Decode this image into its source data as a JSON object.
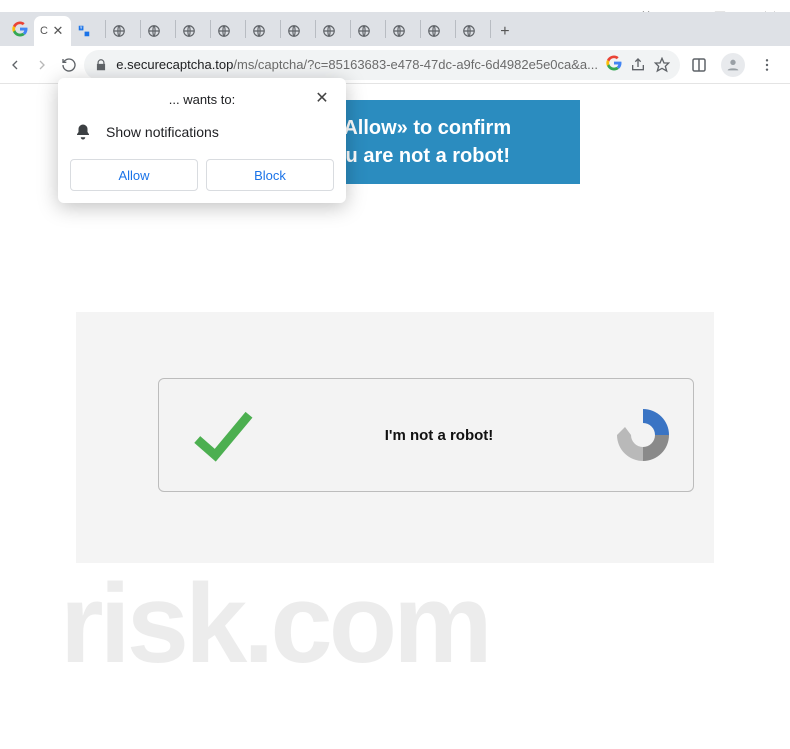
{
  "window": {
    "active_tab_label": "C",
    "newtab_tooltip": "New tab"
  },
  "toolbar": {
    "url_host": "e.securecaptcha.top",
    "url_path": "/ms/captcha/?c=85163683-e478-47dc-a9fc-6d4982e5e0ca&a..."
  },
  "banner": {
    "line1": "Click «Allow» to confirm",
    "line2": "that you are not a robot!"
  },
  "captcha": {
    "text": "I'm not a robot!"
  },
  "permission_prompt": {
    "title": "... wants to:",
    "message": "Show notifications",
    "allow": "Allow",
    "block": "Block"
  },
  "watermark": {
    "text": "risk.com"
  }
}
